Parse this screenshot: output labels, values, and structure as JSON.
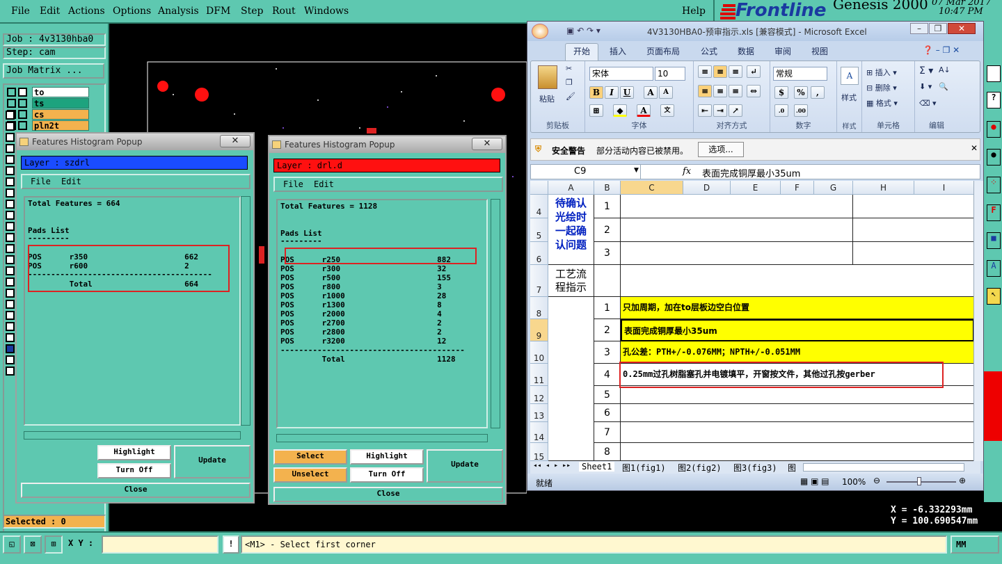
{
  "menubar": {
    "items": [
      "File",
      "Edit",
      "Actions",
      "Options",
      "Analysis",
      "DFM",
      "Step",
      "Rout",
      "Windows"
    ],
    "help": "Help"
  },
  "logo": {
    "brand": "Frontline",
    "product": "Genesis 2000",
    "date": "07 Mar 2017",
    "time": "10:47 PM"
  },
  "left_panel": {
    "job": "Job : 4v3130hba0",
    "step": "Step: cam",
    "job_matrix": "Job Matrix ...",
    "layers": [
      {
        "name": "to",
        "color": "#ffffff"
      },
      {
        "name": "ts",
        "color": "#1da37e"
      },
      {
        "name": "cs",
        "color": "#f3b24e"
      },
      {
        "name": "pln2t",
        "color": "#f3b24e"
      }
    ],
    "selected": "Selected : 0"
  },
  "popup1": {
    "title": "Features Histogram Popup",
    "layer": "Layer :  szdrl",
    "layer_color": "#1a4cff",
    "menu": [
      "File",
      "Edit"
    ],
    "lines": [
      "Total Features = 664",
      "",
      "",
      "Pads List",
      "---------",
      "",
      "POS      r350                     662",
      "POS      r600                     2",
      "----------------------------------------",
      "         Total                    664"
    ],
    "buttons": {
      "highlight": "Highlight",
      "turn_off": "Turn Off",
      "update": "Update",
      "close": "Close"
    }
  },
  "popup2": {
    "title": "Features Histogram Popup",
    "layer": "Layer :  drl.d",
    "layer_color": "#ff1010",
    "menu": [
      "File",
      "Edit"
    ],
    "lines": [
      "Total Features = 1128",
      "",
      "",
      "Pads List",
      "---------",
      "",
      "POS      r250                     882",
      "POS      r300                     32",
      "POS      r500                     155",
      "POS      r800                     3",
      "POS      r1000                    28",
      "POS      r1300                    8",
      "POS      r2000                    4",
      "POS      r2700                    2",
      "POS      r2800                    2",
      "POS      r3200                    12",
      "----------------------------------------",
      "         Total                    1128"
    ],
    "buttons": {
      "select": "Select",
      "unselect": "Unselect",
      "highlight": "Highlight",
      "turn_off": "Turn Off",
      "update": "Update",
      "close": "Close"
    }
  },
  "excel": {
    "title": "4V3130HBA0-预审指示.xls [兼容模式] - Microsoft Excel",
    "tabs": [
      "开始",
      "插入",
      "页面布局",
      "公式",
      "数据",
      "审阅",
      "视图"
    ],
    "font_name": "宋体",
    "font_size": "10",
    "number_format": "常规",
    "groups": [
      "剪贴板",
      "字体",
      "对齐方式",
      "数字",
      "样式",
      "单元格",
      "编辑"
    ],
    "buttons": {
      "paste": "粘贴",
      "style": "样式",
      "insert": "插入",
      "delete": "删除",
      "format": "格式"
    },
    "security": {
      "title": "安全警告",
      "msg": "部分活动内容已被禁用。",
      "options": "选项..."
    },
    "namebox": "C9",
    "fx": "fx",
    "formula": "表面完成铜厚最小35um",
    "columns": [
      "A",
      "B",
      "C",
      "D",
      "E",
      "F",
      "G",
      "H",
      "I"
    ],
    "rows": [
      "4",
      "5",
      "6",
      "7",
      "8",
      "9",
      "10",
      "11",
      "12",
      "13",
      "14",
      "15"
    ],
    "confirm_text": "待确认光绘时一起确认问题",
    "process_text": "工艺流程指示",
    "b_values": [
      "1",
      "2",
      "3",
      "1",
      "2",
      "3",
      "4",
      "5",
      "6",
      "7",
      "8"
    ],
    "c_texts": [
      "只加周期，加在to层板边空白位置",
      "表面完成铜厚最小35um",
      "孔公差：PTH+/-0.076MM；NPTH+/-0.051MM",
      "0.25mm过孔树脂塞孔并电镀填平，开窗按文件，其他过孔按gerber"
    ],
    "sheets": [
      "Sheet1",
      "图1(fig1)",
      "图2(fig2)",
      "图3(fig3)",
      "图"
    ],
    "status": "就绪",
    "zoom": "100%"
  },
  "coords": {
    "x": "X = -6.332293mm",
    "y": "Y = 100.690547mm"
  },
  "bottom": {
    "xy_label": "X Y :",
    "xy_value": "",
    "prompt": "<M1> - Select first corner",
    "unit": "MM"
  }
}
